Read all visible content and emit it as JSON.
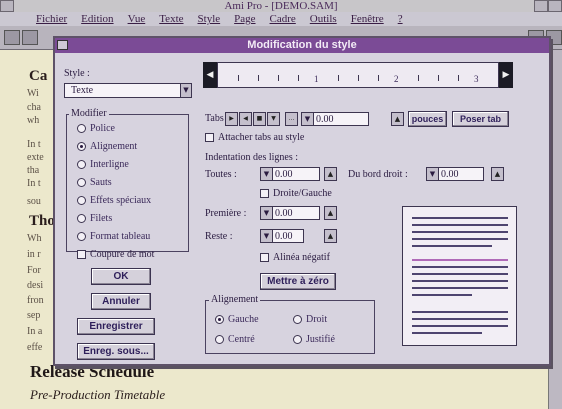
{
  "app": {
    "title": "Ami Pro - [DEMO.SAM]",
    "menu": [
      "Fichier",
      "Edition",
      "Vue",
      "Texte",
      "Style",
      "Page",
      "Cadre",
      "Outils",
      "Fenêtre",
      "?"
    ]
  },
  "document": {
    "heading1": "Ca",
    "heading2": "Tho",
    "para1_lines": [
      "Wi",
      "cha",
      "wh",
      "In t",
      "exte",
      "tha",
      "In t",
      "sou"
    ],
    "para2_lines": [
      "Wh",
      "in r",
      "For",
      "desi",
      "fron",
      "sep",
      "In a",
      "effe"
    ],
    "release_title": "Release Schedule",
    "pretime": "Pre-Production Timetable"
  },
  "dialog": {
    "title": "Modification du style",
    "style_label": "Style :",
    "style_value": "Texte",
    "modifier_label": "Modifier",
    "modifier_options": [
      {
        "label": "Police",
        "selected": false
      },
      {
        "label": "Alignement",
        "selected": true
      },
      {
        "label": "Interligne",
        "selected": false
      },
      {
        "label": "Sauts",
        "selected": false
      },
      {
        "label": "Effets spéciaux",
        "selected": false
      },
      {
        "label": "Filets",
        "selected": false
      },
      {
        "label": "Format tableau",
        "selected": false
      }
    ],
    "coupure_label": "Coupure de mot",
    "buttons": {
      "ok": "OK",
      "annuler": "Annuler",
      "enregistrer": "Enregistrer",
      "enreg_sous": "Enreg. sous..."
    },
    "ruler_numbers": [
      "1",
      "2",
      "3"
    ],
    "tabs_label": "Tabs",
    "tabs_value": "0.00",
    "unit_button": "pouces",
    "poser_tab": "Poser tab",
    "attacher_label": "Attacher tabs au style",
    "indentation_label": "Indentation des lignes :",
    "toutes_label": "Toutes :",
    "toutes_value": "0.00",
    "bord_droit_label": "Du bord droit :",
    "bord_droit_value": "0.00",
    "droite_gauche_label": "Droite/Gauche",
    "premiere_label": "Première :",
    "premiere_value": "0.00",
    "reste_label": "Reste :",
    "reste_value": "0.00",
    "alinea_negatif_label": "Alinéa négatif",
    "mettre_zero": "Mettre à zéro",
    "alignement_label": "Alignement",
    "align_options": [
      {
        "label": "Gauche",
        "selected": true
      },
      {
        "label": "Droit",
        "selected": false
      },
      {
        "label": "Centré",
        "selected": false
      },
      {
        "label": "Justifié",
        "selected": false
      }
    ]
  },
  "colors": {
    "dialog_title_bar": "#7b4b96",
    "document_bg": "#ece8cc",
    "preview_line": "#4e4470",
    "preview_highlight": "#b06ab8"
  }
}
